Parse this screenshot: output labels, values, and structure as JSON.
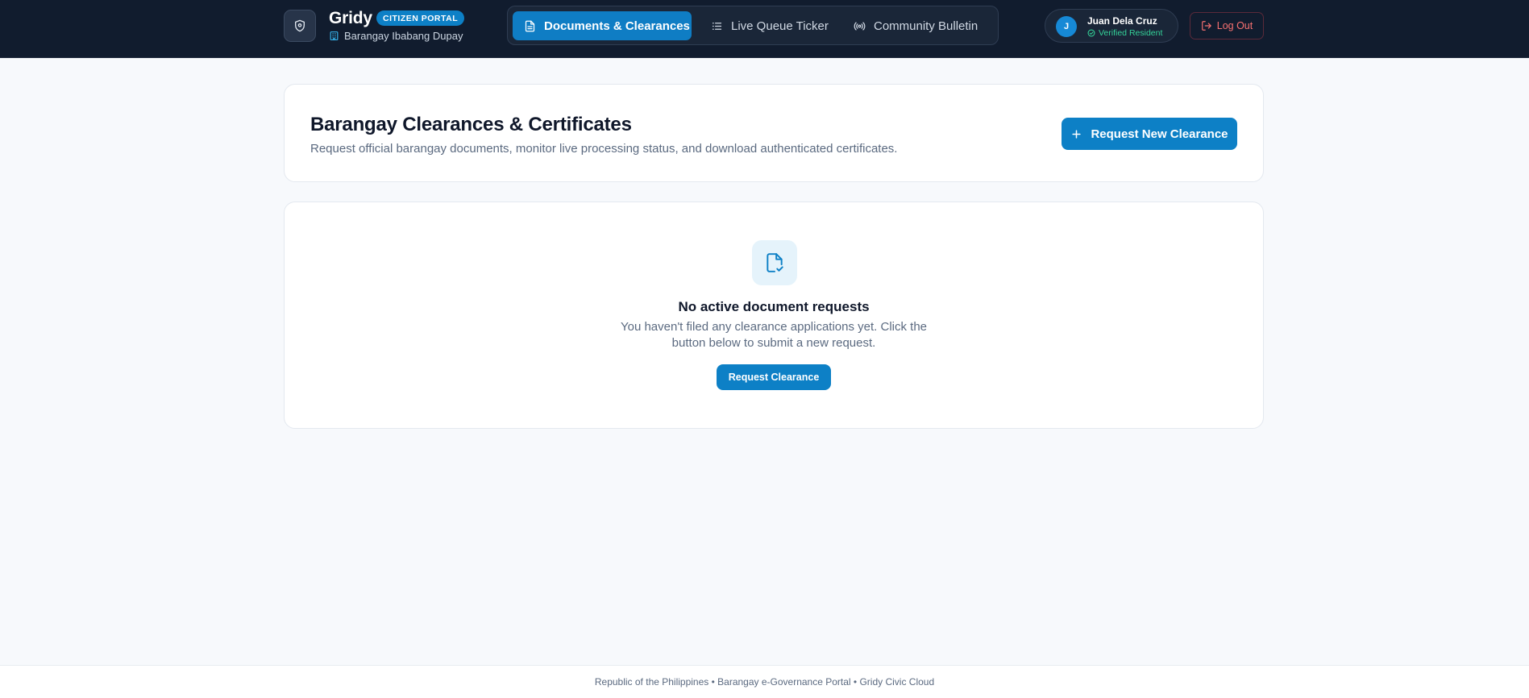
{
  "header": {
    "brand_name": "Gridy",
    "brand_badge": "CITIZEN PORTAL",
    "barangay_name": "Barangay Ibabang Dupay",
    "tabs": [
      {
        "label": "Documents & Clearances",
        "icon": "document-icon",
        "active": true
      },
      {
        "label": "Live Queue Ticker",
        "icon": "list-icon",
        "active": false
      },
      {
        "label": "Community Bulletin",
        "icon": "broadcast-icon",
        "active": false
      }
    ],
    "user": {
      "initial": "J",
      "name": "Juan Dela Cruz",
      "status": "Verified Resident"
    },
    "logout_label": "Log Out"
  },
  "page": {
    "title": "Barangay Clearances & Certificates",
    "subtitle": "Request official barangay documents, monitor live processing status, and download authenticated certificates.",
    "request_new_label": "Request New Clearance"
  },
  "empty_state": {
    "title": "No active document requests",
    "message": "You haven't filed any clearance applications yet. Click the button below to submit a new request.",
    "button_label": "Request Clearance"
  },
  "footer": {
    "text": "Republic of the Philippines • Barangay e-Governance Portal • Gridy Civic Cloud"
  },
  "colors": {
    "header_bg": "#111c2e",
    "primary": "#0d80c6",
    "verified": "#34d399",
    "logout": "#f87171",
    "page_bg": "#f7f9fc"
  }
}
